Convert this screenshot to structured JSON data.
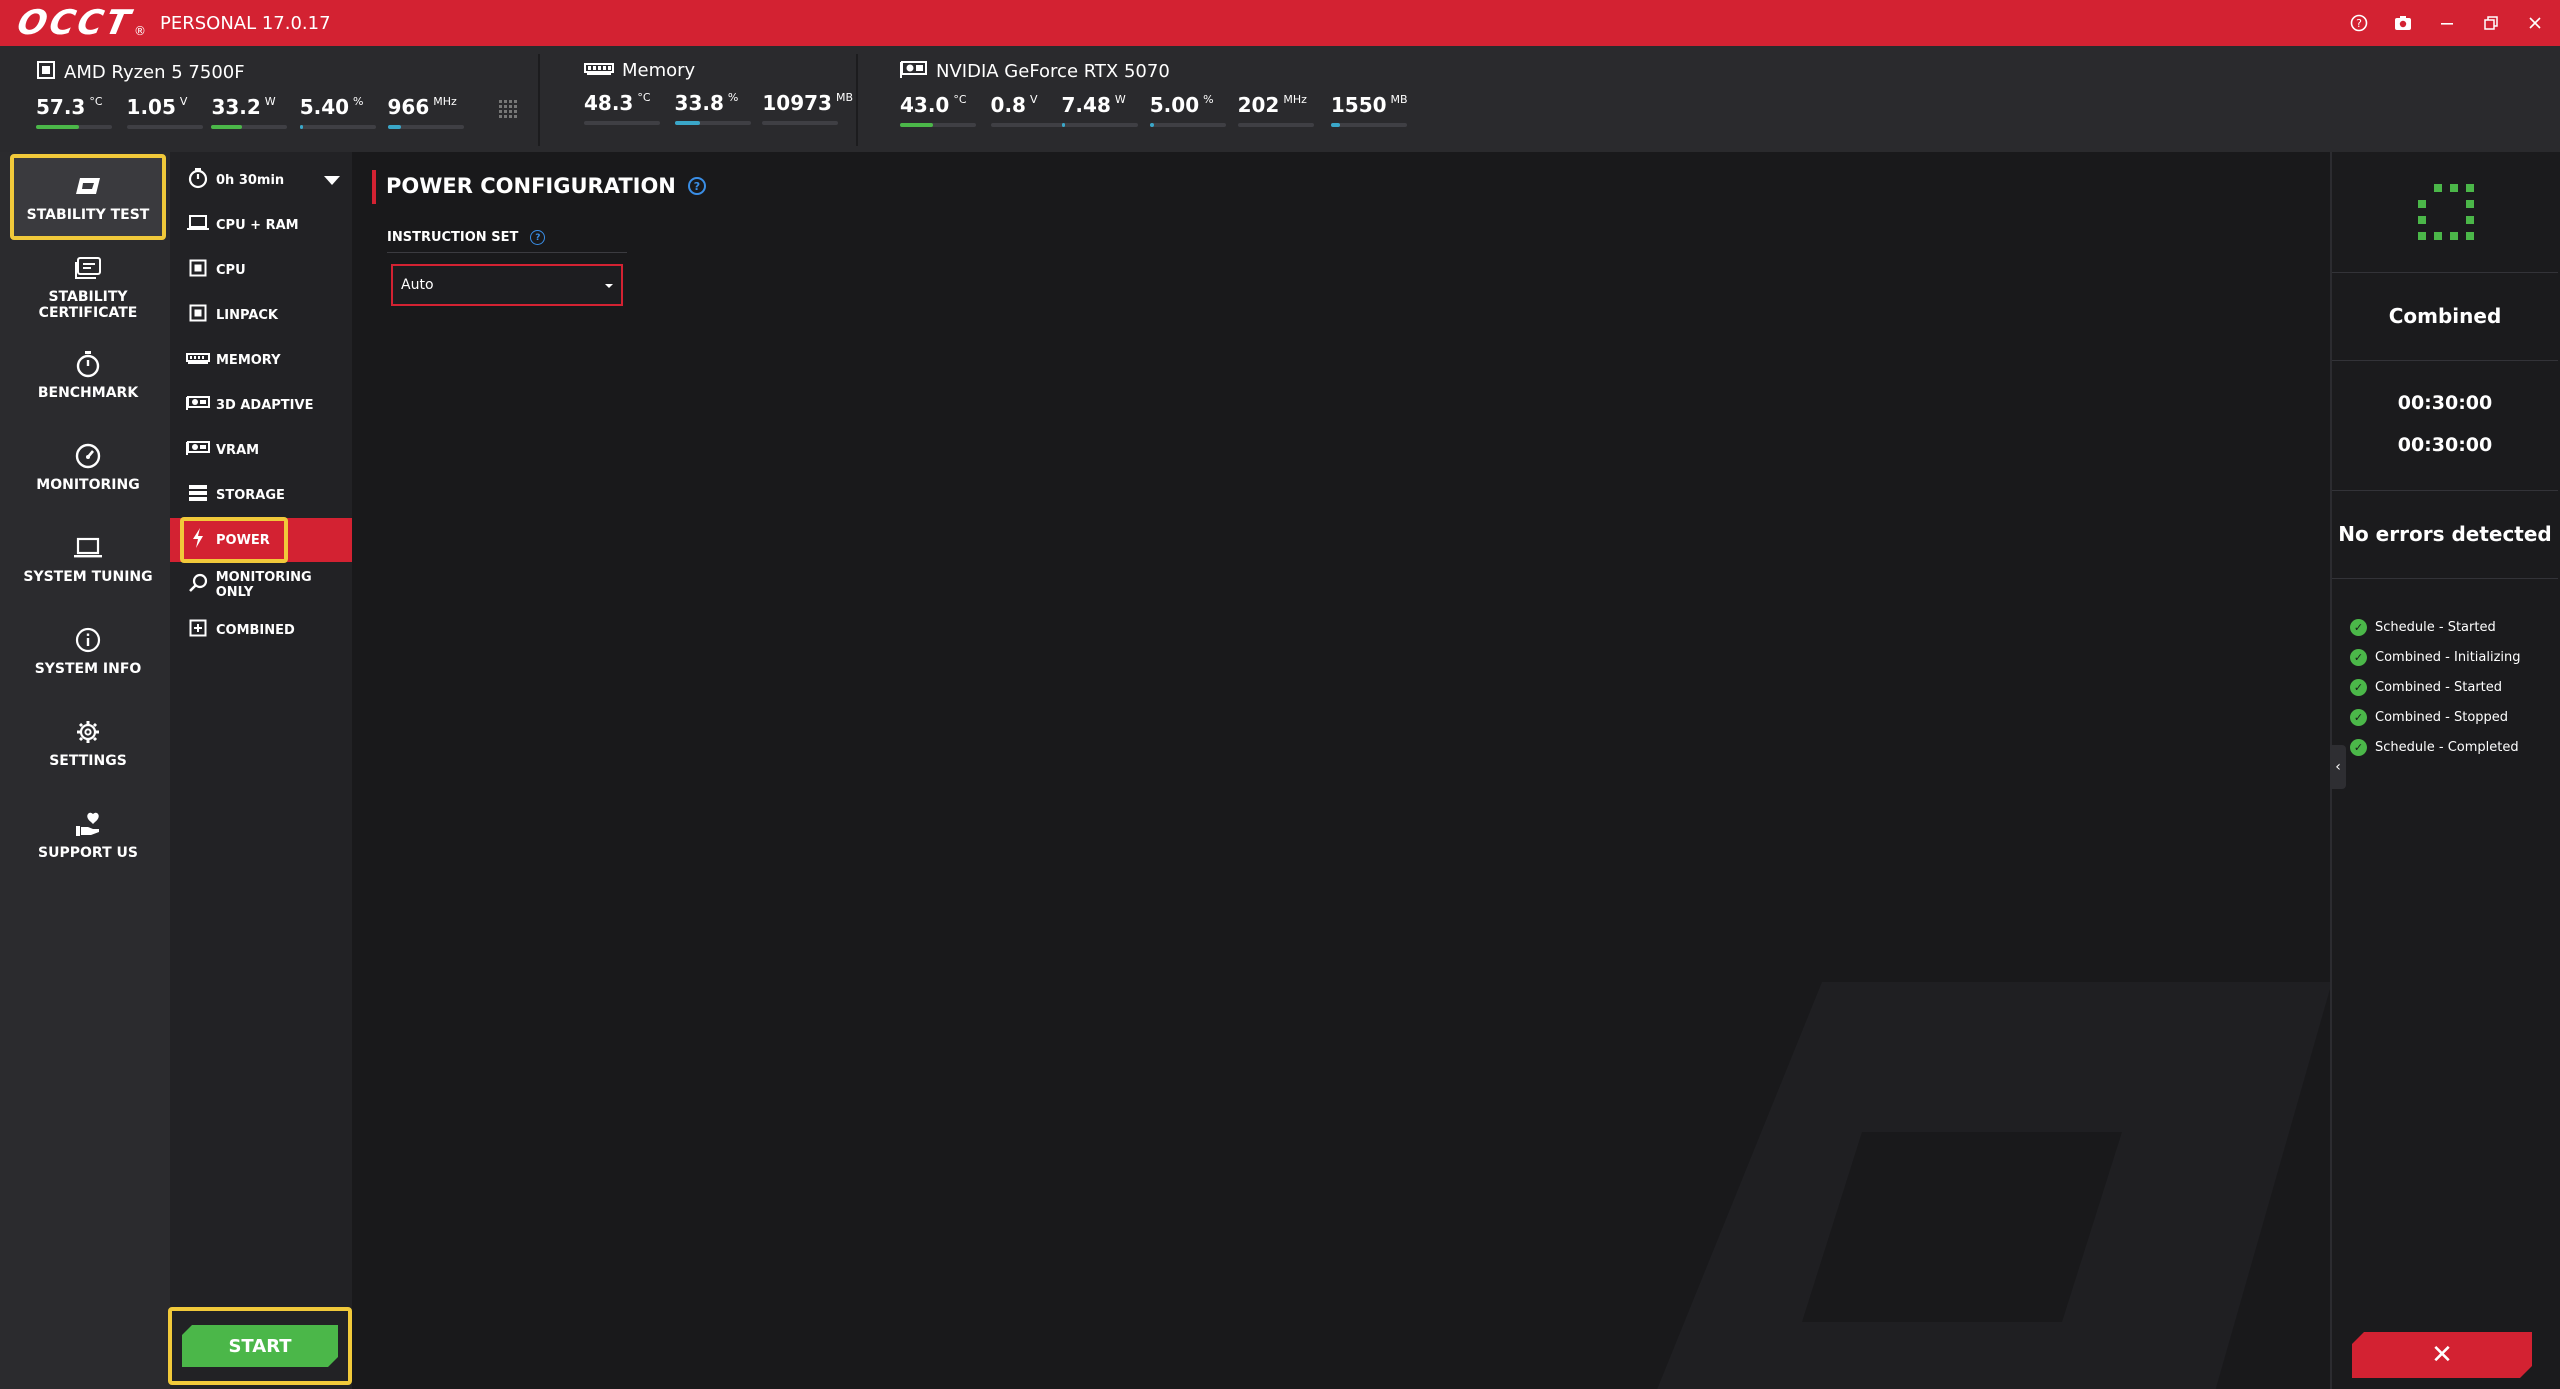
{
  "app": {
    "logo": "OCCT",
    "logo_reg": "®",
    "title": "PERSONAL 17.0.17",
    "window_controls": [
      "help-icon",
      "screenshot-icon",
      "minimize-icon",
      "restore-icon",
      "close-icon"
    ]
  },
  "sensors": {
    "cpu": {
      "name": "AMD Ryzen 5 7500F",
      "icon": "cpu-chip-icon",
      "values": [
        {
          "value": "57.3",
          "unit": "°C",
          "fill": 0.57,
          "color": "#4bb749"
        },
        {
          "value": "1.05",
          "unit": "V",
          "fill": 0,
          "color": "#4bb749"
        },
        {
          "value": "33.2",
          "unit": "W",
          "fill": 0.4,
          "color": "#4bb749"
        },
        {
          "value": "5.40",
          "unit": "%",
          "fill": 0.05,
          "color": "#3aa7c9"
        },
        {
          "value": "966",
          "unit": "MHz",
          "fill": 0.18,
          "color": "#3aa7c9"
        }
      ]
    },
    "memory": {
      "name": "Memory",
      "icon": "memory-stick-icon",
      "values": [
        {
          "value": "48.3",
          "unit": "°C",
          "fill": 0,
          "color": "#4bb749"
        },
        {
          "value": "33.8",
          "unit": "%",
          "fill": 0.34,
          "color": "#3aa7c9"
        },
        {
          "value": "10973",
          "unit": "MB",
          "fill": 0,
          "color": "#3aa7c9"
        }
      ]
    },
    "gpu": {
      "name": "NVIDIA GeForce RTX 5070",
      "icon": "gpu-card-icon",
      "values": [
        {
          "value": "43.0",
          "unit": "°C",
          "fill": 0.43,
          "color": "#4bb749"
        },
        {
          "value": "0.8",
          "unit": "V",
          "fill": 0,
          "color": "#4bb749"
        },
        {
          "value": "7.48",
          "unit": "W",
          "fill": 0.05,
          "color": "#3aa7c9"
        },
        {
          "value": "5.00",
          "unit": "%",
          "fill": 0.05,
          "color": "#3aa7c9"
        },
        {
          "value": "202",
          "unit": "MHz",
          "fill": 0,
          "color": "#3aa7c9"
        },
        {
          "value": "1550",
          "unit": "MB",
          "fill": 0.12,
          "color": "#3aa7c9"
        }
      ]
    }
  },
  "leftnav": [
    {
      "label": "STABILITY TEST",
      "icon": "occt-logo-icon",
      "active": true
    },
    {
      "label": "STABILITY CERTIFICATE",
      "icon": "certificate-icon",
      "active": false
    },
    {
      "label": "BENCHMARK",
      "icon": "stopwatch-icon",
      "active": false
    },
    {
      "label": "MONITORING",
      "icon": "gauge-icon",
      "active": false
    },
    {
      "label": "SYSTEM TUNING",
      "icon": "laptop-icon",
      "active": false
    },
    {
      "label": "SYSTEM INFO",
      "icon": "info-icon",
      "active": false
    },
    {
      "label": "SETTINGS",
      "icon": "gear-icon",
      "active": false
    },
    {
      "label": "SUPPORT US",
      "icon": "heart-hand-icon",
      "active": false
    }
  ],
  "subnav": {
    "duration": "0h 30min",
    "items": [
      {
        "label": "CPU + RAM",
        "icon": "laptop-icon",
        "active": false
      },
      {
        "label": "CPU",
        "icon": "cpu-chip-icon",
        "active": false
      },
      {
        "label": "LINPACK",
        "icon": "cpu-chip-icon",
        "active": false
      },
      {
        "label": "MEMORY",
        "icon": "memory-stick-icon",
        "active": false
      },
      {
        "label": "3D ADAPTIVE",
        "icon": "gpu-card-icon",
        "active": false
      },
      {
        "label": "VRAM",
        "icon": "gpu-card-icon",
        "active": false
      },
      {
        "label": "STORAGE",
        "icon": "storage-icon",
        "active": false
      },
      {
        "label": "POWER",
        "icon": "lightning-icon",
        "active": true
      },
      {
        "label": "MONITORING ONLY",
        "icon": "magnifier-icon",
        "active": false
      },
      {
        "label": "COMBINED",
        "icon": "plus-box-icon",
        "active": false
      }
    ],
    "start_label": "START"
  },
  "main": {
    "section_title": "POWER CONFIGURATION",
    "instruction_label": "INSTRUCTION SET",
    "instruction_value": "Auto"
  },
  "rightpanel": {
    "test_name": "Combined",
    "elapsed": "00:30:00",
    "total": "00:30:00",
    "status": "No errors detected",
    "events": [
      "Schedule - Started",
      "Combined - Initializing",
      "Combined - Started",
      "Combined - Stopped",
      "Schedule - Completed"
    ],
    "stop_label": "✕"
  }
}
